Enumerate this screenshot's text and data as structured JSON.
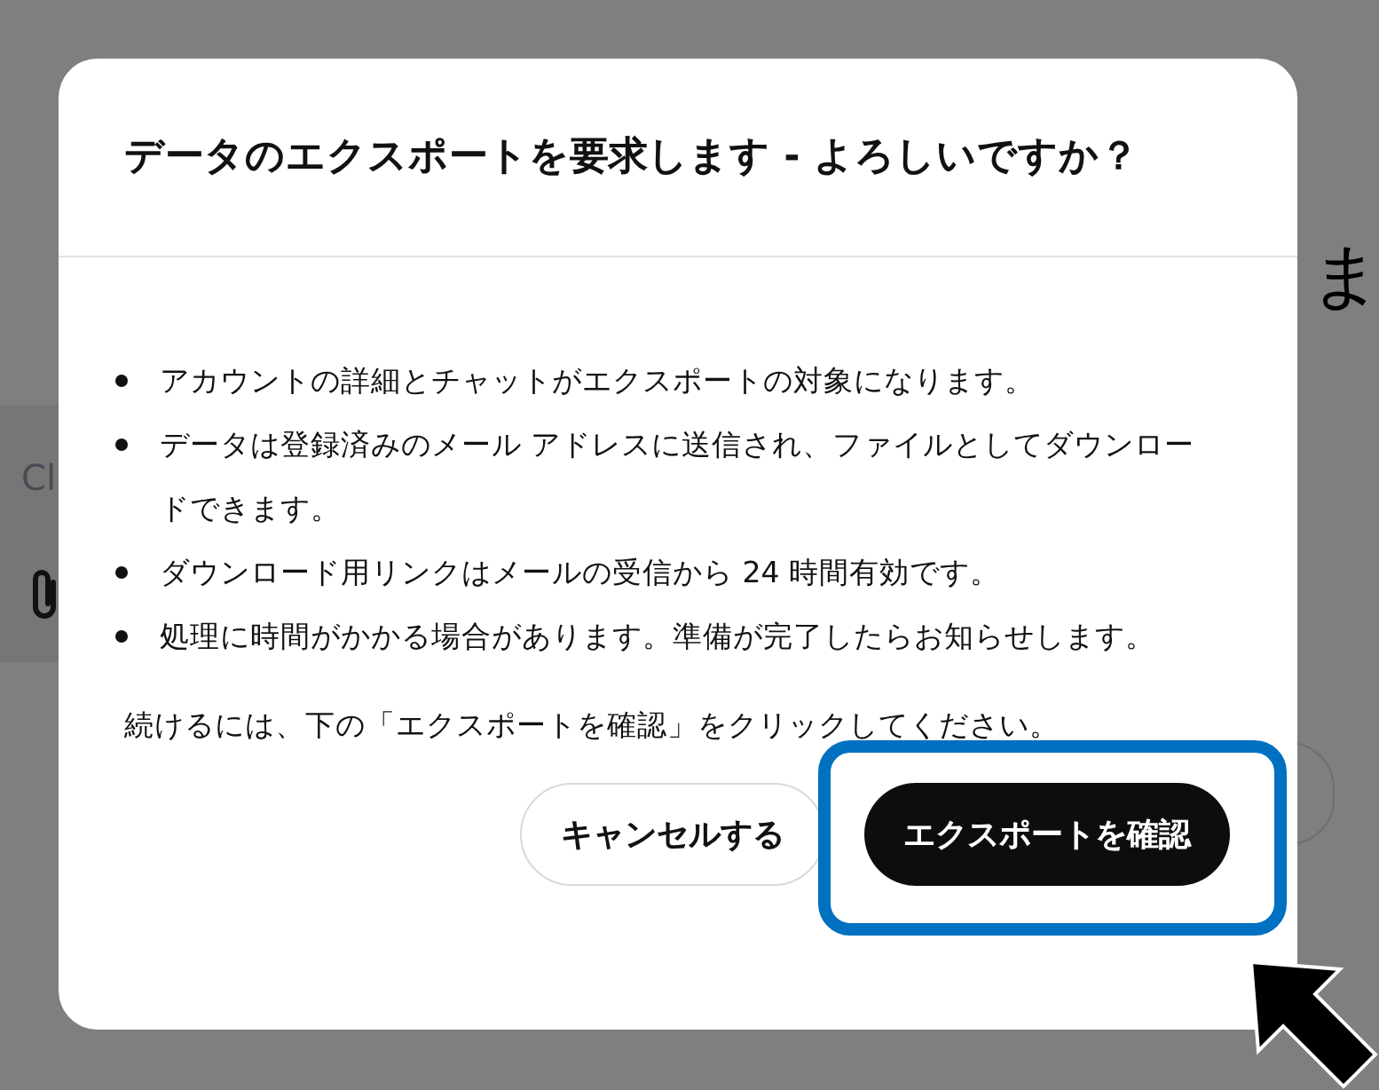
{
  "background": {
    "heading_fragment": "ま",
    "composer_fragment": "Cl"
  },
  "dialog": {
    "title": "データのエクスポートを要求します - よろしいですか？",
    "items": [
      "アカウントの詳細とチャットがエクスポートの対象になります。",
      "データは登録済みのメール アドレスに送信され、ファイルとしてダウンロードできます。",
      "ダウンロード用リンクはメールの受信から 24 時間有効です。",
      "処理に時間がかかる場合があります。準備が完了したらお知らせします。"
    ],
    "note": "続けるには、下の「エクスポートを確認」をクリックしてください。",
    "buttons": [
      {
        "label": "キャンセルする",
        "kind": "secondary",
        "highlighted": false
      },
      {
        "label": "エクスポートを確認",
        "kind": "primary",
        "highlighted": true
      }
    ]
  }
}
